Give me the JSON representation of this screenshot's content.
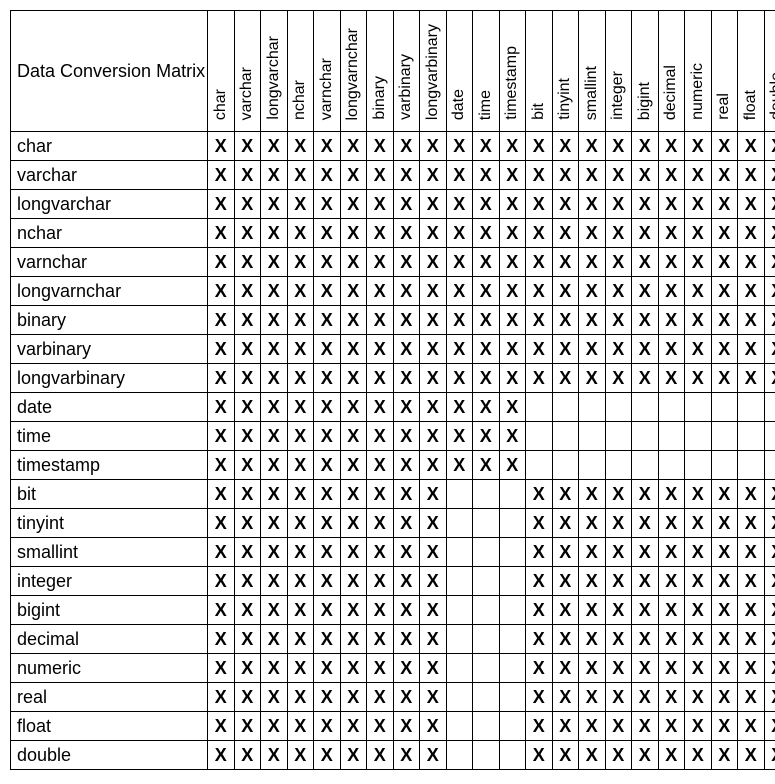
{
  "chart_data": {
    "type": "table",
    "title": "Data Conversion Matrix",
    "columns": [
      "char",
      "varchar",
      "longvarchar",
      "nchar",
      "varnchar",
      "longvarnchar",
      "binary",
      "varbinary",
      "longvarbinary",
      "date",
      "time",
      "timestamp",
      "bit",
      "tinyint",
      "smallint",
      "integer",
      "bigint",
      "decimal",
      "numeric",
      "real",
      "float",
      "double"
    ],
    "rows": [
      "char",
      "varchar",
      "longvarchar",
      "nchar",
      "varnchar",
      "longvarnchar",
      "binary",
      "varbinary",
      "longvarbinary",
      "date",
      "time",
      "timestamp",
      "bit",
      "tinyint",
      "smallint",
      "integer",
      "bigint",
      "decimal",
      "numeric",
      "real",
      "float",
      "double"
    ],
    "mark": "X",
    "matrix": [
      [
        1,
        1,
        1,
        1,
        1,
        1,
        1,
        1,
        1,
        1,
        1,
        1,
        1,
        1,
        1,
        1,
        1,
        1,
        1,
        1,
        1,
        1
      ],
      [
        1,
        1,
        1,
        1,
        1,
        1,
        1,
        1,
        1,
        1,
        1,
        1,
        1,
        1,
        1,
        1,
        1,
        1,
        1,
        1,
        1,
        1
      ],
      [
        1,
        1,
        1,
        1,
        1,
        1,
        1,
        1,
        1,
        1,
        1,
        1,
        1,
        1,
        1,
        1,
        1,
        1,
        1,
        1,
        1,
        1
      ],
      [
        1,
        1,
        1,
        1,
        1,
        1,
        1,
        1,
        1,
        1,
        1,
        1,
        1,
        1,
        1,
        1,
        1,
        1,
        1,
        1,
        1,
        1
      ],
      [
        1,
        1,
        1,
        1,
        1,
        1,
        1,
        1,
        1,
        1,
        1,
        1,
        1,
        1,
        1,
        1,
        1,
        1,
        1,
        1,
        1,
        1
      ],
      [
        1,
        1,
        1,
        1,
        1,
        1,
        1,
        1,
        1,
        1,
        1,
        1,
        1,
        1,
        1,
        1,
        1,
        1,
        1,
        1,
        1,
        1
      ],
      [
        1,
        1,
        1,
        1,
        1,
        1,
        1,
        1,
        1,
        1,
        1,
        1,
        1,
        1,
        1,
        1,
        1,
        1,
        1,
        1,
        1,
        1
      ],
      [
        1,
        1,
        1,
        1,
        1,
        1,
        1,
        1,
        1,
        1,
        1,
        1,
        1,
        1,
        1,
        1,
        1,
        1,
        1,
        1,
        1,
        1
      ],
      [
        1,
        1,
        1,
        1,
        1,
        1,
        1,
        1,
        1,
        1,
        1,
        1,
        1,
        1,
        1,
        1,
        1,
        1,
        1,
        1,
        1,
        1
      ],
      [
        1,
        1,
        1,
        1,
        1,
        1,
        1,
        1,
        1,
        1,
        1,
        1,
        0,
        0,
        0,
        0,
        0,
        0,
        0,
        0,
        0,
        0
      ],
      [
        1,
        1,
        1,
        1,
        1,
        1,
        1,
        1,
        1,
        1,
        1,
        1,
        0,
        0,
        0,
        0,
        0,
        0,
        0,
        0,
        0,
        0
      ],
      [
        1,
        1,
        1,
        1,
        1,
        1,
        1,
        1,
        1,
        1,
        1,
        1,
        0,
        0,
        0,
        0,
        0,
        0,
        0,
        0,
        0,
        0
      ],
      [
        1,
        1,
        1,
        1,
        1,
        1,
        1,
        1,
        1,
        0,
        0,
        0,
        1,
        1,
        1,
        1,
        1,
        1,
        1,
        1,
        1,
        1
      ],
      [
        1,
        1,
        1,
        1,
        1,
        1,
        1,
        1,
        1,
        0,
        0,
        0,
        1,
        1,
        1,
        1,
        1,
        1,
        1,
        1,
        1,
        1
      ],
      [
        1,
        1,
        1,
        1,
        1,
        1,
        1,
        1,
        1,
        0,
        0,
        0,
        1,
        1,
        1,
        1,
        1,
        1,
        1,
        1,
        1,
        1
      ],
      [
        1,
        1,
        1,
        1,
        1,
        1,
        1,
        1,
        1,
        0,
        0,
        0,
        1,
        1,
        1,
        1,
        1,
        1,
        1,
        1,
        1,
        1
      ],
      [
        1,
        1,
        1,
        1,
        1,
        1,
        1,
        1,
        1,
        0,
        0,
        0,
        1,
        1,
        1,
        1,
        1,
        1,
        1,
        1,
        1,
        1
      ],
      [
        1,
        1,
        1,
        1,
        1,
        1,
        1,
        1,
        1,
        0,
        0,
        0,
        1,
        1,
        1,
        1,
        1,
        1,
        1,
        1,
        1,
        1
      ],
      [
        1,
        1,
        1,
        1,
        1,
        1,
        1,
        1,
        1,
        0,
        0,
        0,
        1,
        1,
        1,
        1,
        1,
        1,
        1,
        1,
        1,
        1
      ],
      [
        1,
        1,
        1,
        1,
        1,
        1,
        1,
        1,
        1,
        0,
        0,
        0,
        1,
        1,
        1,
        1,
        1,
        1,
        1,
        1,
        1,
        1
      ],
      [
        1,
        1,
        1,
        1,
        1,
        1,
        1,
        1,
        1,
        0,
        0,
        0,
        1,
        1,
        1,
        1,
        1,
        1,
        1,
        1,
        1,
        1
      ],
      [
        1,
        1,
        1,
        1,
        1,
        1,
        1,
        1,
        1,
        0,
        0,
        0,
        1,
        1,
        1,
        1,
        1,
        1,
        1,
        1,
        1,
        1
      ]
    ]
  }
}
